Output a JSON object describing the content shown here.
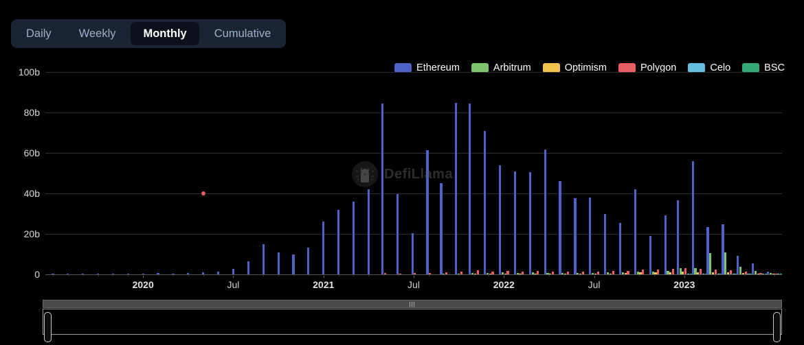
{
  "tabs": [
    {
      "label": "Daily",
      "active": false
    },
    {
      "label": "Weekly",
      "active": false
    },
    {
      "label": "Monthly",
      "active": true
    },
    {
      "label": "Cumulative",
      "active": false
    }
  ],
  "watermark": {
    "text": "DefiLlama",
    "logo_icon": "llama-logo-icon"
  },
  "datazoom": {
    "grip_icon": "drag-grip-icon",
    "left_handle_icon": "range-handle-left-icon",
    "right_handle_icon": "range-handle-right-icon",
    "start_percent": 0,
    "end_percent": 100
  },
  "colors": {
    "Ethereum": "#4f62c8",
    "Arbitrum": "#7ec46f",
    "Optimism": "#f2c14e",
    "Polygon": "#ea5f63",
    "Celo": "#63bfdd",
    "BSC": "#35a97a",
    "background": "#000000",
    "grid": "#2e2e2e",
    "tabbar_bg": "#1a2433",
    "tab_active_bg": "#0b101b"
  },
  "chart_data": {
    "type": "bar",
    "title": "",
    "xlabel": "",
    "ylabel": "",
    "ylim": [
      0,
      100
    ],
    "ytick_labels": [
      "0",
      "20b",
      "40b",
      "60b",
      "80b",
      "100b"
    ],
    "ytick_values": [
      0,
      20,
      40,
      60,
      80,
      100
    ],
    "grid": true,
    "legend_position": "top-right",
    "stacked": false,
    "units": "billions USD",
    "x_axis_ticks": [
      {
        "label": "2020",
        "index": 6
      },
      {
        "label": "Jul",
        "index": 12
      },
      {
        "label": "2021",
        "index": 18
      },
      {
        "label": "Jul",
        "index": 24
      },
      {
        "label": "2022",
        "index": 30
      },
      {
        "label": "Jul",
        "index": 36
      },
      {
        "label": "2023",
        "index": 42
      }
    ],
    "categories": [
      "2019-07",
      "2019-08",
      "2019-09",
      "2019-10",
      "2019-11",
      "2019-12",
      "2020-01",
      "2020-02",
      "2020-03",
      "2020-04",
      "2020-05",
      "2020-06",
      "2020-07",
      "2020-08",
      "2020-09",
      "2020-10",
      "2020-11",
      "2020-12",
      "2021-01",
      "2021-02",
      "2021-03",
      "2021-04",
      "2021-05",
      "2021-06",
      "2021-07",
      "2021-08",
      "2021-09",
      "2021-10",
      "2021-11",
      "2021-12",
      "2022-01",
      "2022-02",
      "2022-03",
      "2022-04",
      "2022-05",
      "2022-06",
      "2022-07",
      "2022-08",
      "2022-09",
      "2022-10",
      "2022-11",
      "2022-12",
      "2023-01",
      "2023-02",
      "2023-03",
      "2023-04",
      "2023-05",
      "2023-06",
      "2023-07"
    ],
    "series": [
      {
        "name": "Ethereum",
        "color": "#4f62c8",
        "values": [
          0.1,
          0.1,
          0.2,
          0.2,
          0.2,
          0.3,
          0.4,
          0.6,
          0.5,
          0.6,
          0.9,
          1.4,
          2.6,
          6.3,
          15.0,
          11.0,
          9.8,
          13.2,
          26.0,
          32.0,
          36.0,
          42.0,
          84.5,
          39.5,
          20.5,
          61.5,
          45.0,
          84.8,
          84.5,
          71.0,
          54.0,
          51.0,
          50.5,
          61.8,
          46.0,
          37.5,
          38.0,
          30.0,
          25.5,
          42.0,
          19.0,
          29.0,
          36.5,
          56.0,
          23.5,
          24.8,
          9.0,
          5.5,
          1.5
        ]
      },
      {
        "name": "Arbitrum",
        "color": "#7ec46f",
        "values": [
          0,
          0,
          0,
          0,
          0,
          0,
          0,
          0,
          0,
          0,
          0,
          0,
          0,
          0,
          0,
          0,
          0,
          0,
          0,
          0,
          0,
          0,
          0,
          0,
          0,
          0,
          0.2,
          0.5,
          0.7,
          0.6,
          0.9,
          0.8,
          1.0,
          0.8,
          0.7,
          0.7,
          0.8,
          0.9,
          1.0,
          1.4,
          1.3,
          1.8,
          2.9,
          3.2,
          10.5,
          11.0,
          3.6,
          1.6,
          0.6
        ]
      },
      {
        "name": "Optimism",
        "color": "#f2c14e",
        "values": [
          0,
          0,
          0,
          0,
          0,
          0,
          0,
          0,
          0,
          0,
          0,
          0,
          0,
          0,
          0,
          0,
          0,
          0,
          0,
          0,
          0,
          0,
          0,
          0,
          0,
          0,
          0,
          0,
          0.1,
          0.1,
          0.2,
          0.2,
          0.3,
          0.3,
          0.3,
          0.3,
          0.4,
          0.5,
          0.6,
          0.9,
          0.9,
          1.0,
          1.2,
          1.1,
          1.0,
          1.1,
          0.7,
          0.4,
          0.2
        ]
      },
      {
        "name": "Polygon",
        "color": "#ea5f63",
        "values": [
          0,
          0,
          0,
          0,
          0,
          0,
          0,
          0,
          0,
          0,
          40.0,
          0,
          0,
          0,
          0,
          0,
          0,
          0,
          0,
          0,
          0,
          0,
          0.6,
          0.5,
          0.7,
          0.8,
          1.0,
          1.4,
          1.9,
          1.5,
          1.6,
          1.5,
          1.7,
          1.5,
          1.4,
          1.2,
          1.3,
          1.6,
          1.6,
          2.5,
          2.4,
          2.6,
          3.2,
          2.8,
          2.3,
          2.2,
          1.3,
          0.8,
          0.4
        ]
      },
      {
        "name": "Celo",
        "color": "#63bfdd",
        "values": [
          0,
          0,
          0,
          0,
          0,
          0,
          0,
          0,
          0,
          0,
          0,
          0,
          0,
          0,
          0,
          0,
          0,
          0,
          0,
          0,
          0,
          0,
          0,
          0,
          0,
          0,
          0,
          0,
          0,
          0,
          0,
          0,
          0,
          0,
          0,
          0,
          0,
          0,
          0,
          0,
          0,
          0,
          0.05,
          0.05,
          0.05,
          0.05,
          0.05,
          0.05,
          0.02
        ]
      },
      {
        "name": "BSC",
        "color": "#35a97a",
        "values": [
          0,
          0,
          0,
          0,
          0,
          0,
          0,
          0,
          0,
          0,
          0,
          0,
          0,
          0,
          0,
          0,
          0,
          0,
          0,
          0,
          0,
          0,
          0,
          0,
          0,
          0,
          0,
          0,
          0,
          0,
          0,
          0,
          0,
          0,
          0,
          0,
          0,
          0,
          0,
          0,
          0,
          0,
          0.1,
          0.2,
          0.3,
          0.3,
          0.2,
          0.1,
          0.05
        ]
      }
    ],
    "special_markers": [
      {
        "series": "Polygon",
        "category_index": 10,
        "value": 40.0,
        "rendered_as": "dot"
      }
    ]
  }
}
